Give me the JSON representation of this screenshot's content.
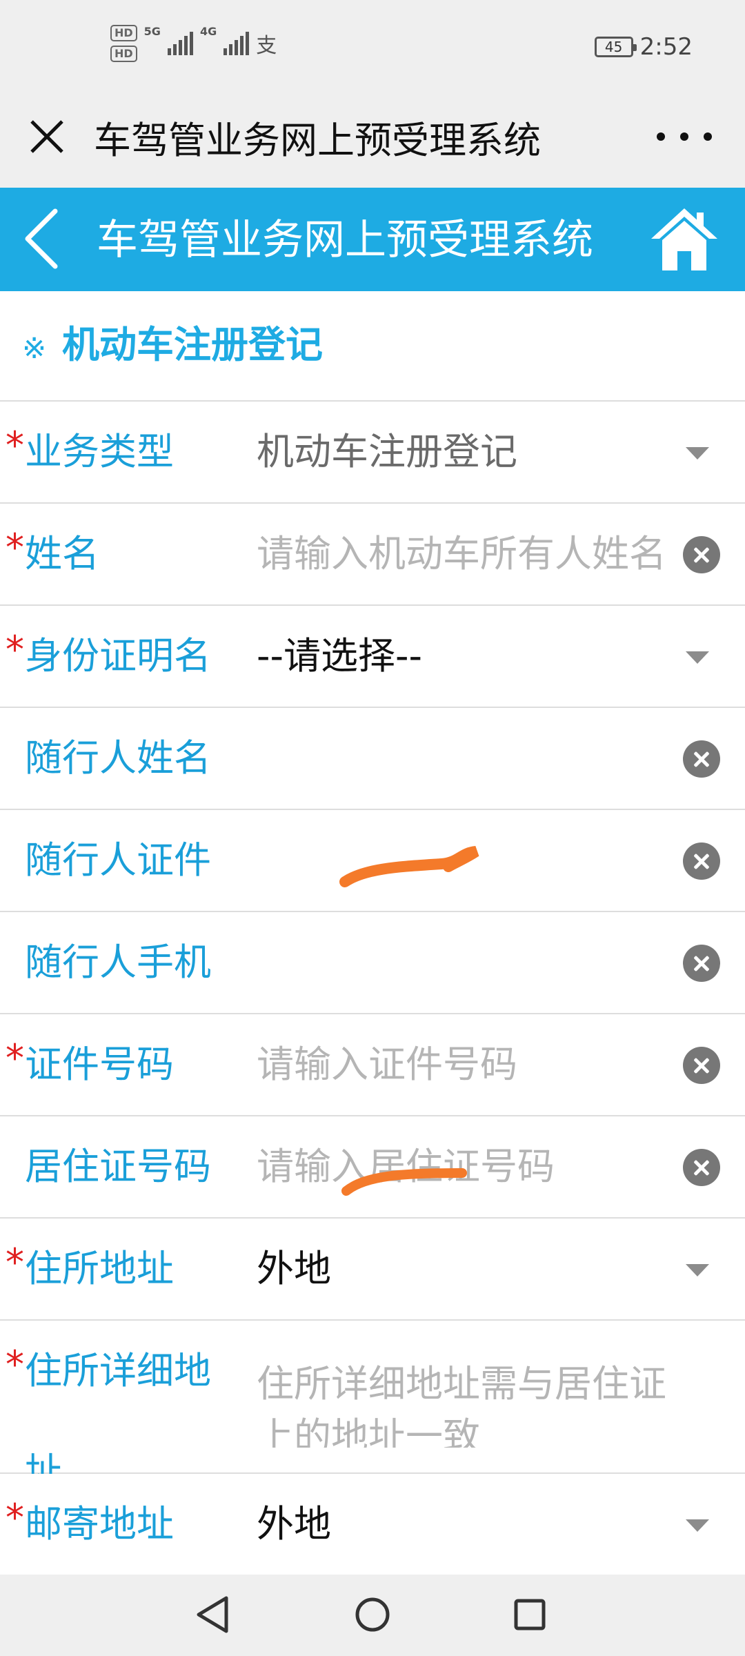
{
  "status": {
    "hd1": "HD",
    "hd2": "HD",
    "net1": "5G",
    "net2": "4G",
    "battery": "45",
    "time": "2:52"
  },
  "titlebar": {
    "title": "车驾管业务网上预受理系统"
  },
  "header": {
    "title": "车驾管业务网上预受理系统"
  },
  "section": {
    "icon": "※",
    "title": "机动车注册登记"
  },
  "form": {
    "required_mark": "*",
    "business_type": {
      "label": "业务类型",
      "value": "机动车注册登记"
    },
    "name": {
      "label": "姓名",
      "placeholder": "请输入机动车所有人姓名"
    },
    "id_type": {
      "label": "身份证明名",
      "value": "--请选择--"
    },
    "companion_name": {
      "label": "随行人姓名"
    },
    "companion_id": {
      "label": "随行人证件"
    },
    "companion_phone": {
      "label": "随行人手机"
    },
    "id_number": {
      "label": "证件号码",
      "placeholder": "请输入证件号码"
    },
    "residence_permit": {
      "label": "居住证号码",
      "placeholder": "请输入居住证号码"
    },
    "address": {
      "label": "住所地址",
      "value": "外地"
    },
    "address_detail": {
      "label_line1": "住所详细地",
      "label_line2": "址",
      "placeholder_line1": "住所详细地址需与居住证",
      "placeholder_line2": "上的地址一致"
    },
    "mail_address": {
      "label": "邮寄地址",
      "value": "外地"
    }
  },
  "icons": {
    "close": "close-icon",
    "more": "more-icon",
    "back": "back-icon",
    "home": "home-icon",
    "dropdown": "chevron-down-icon",
    "clear": "clear-icon"
  },
  "colors": {
    "accent": "#1eabe3",
    "required": "#e02020",
    "scribble": "#f47a2a"
  }
}
